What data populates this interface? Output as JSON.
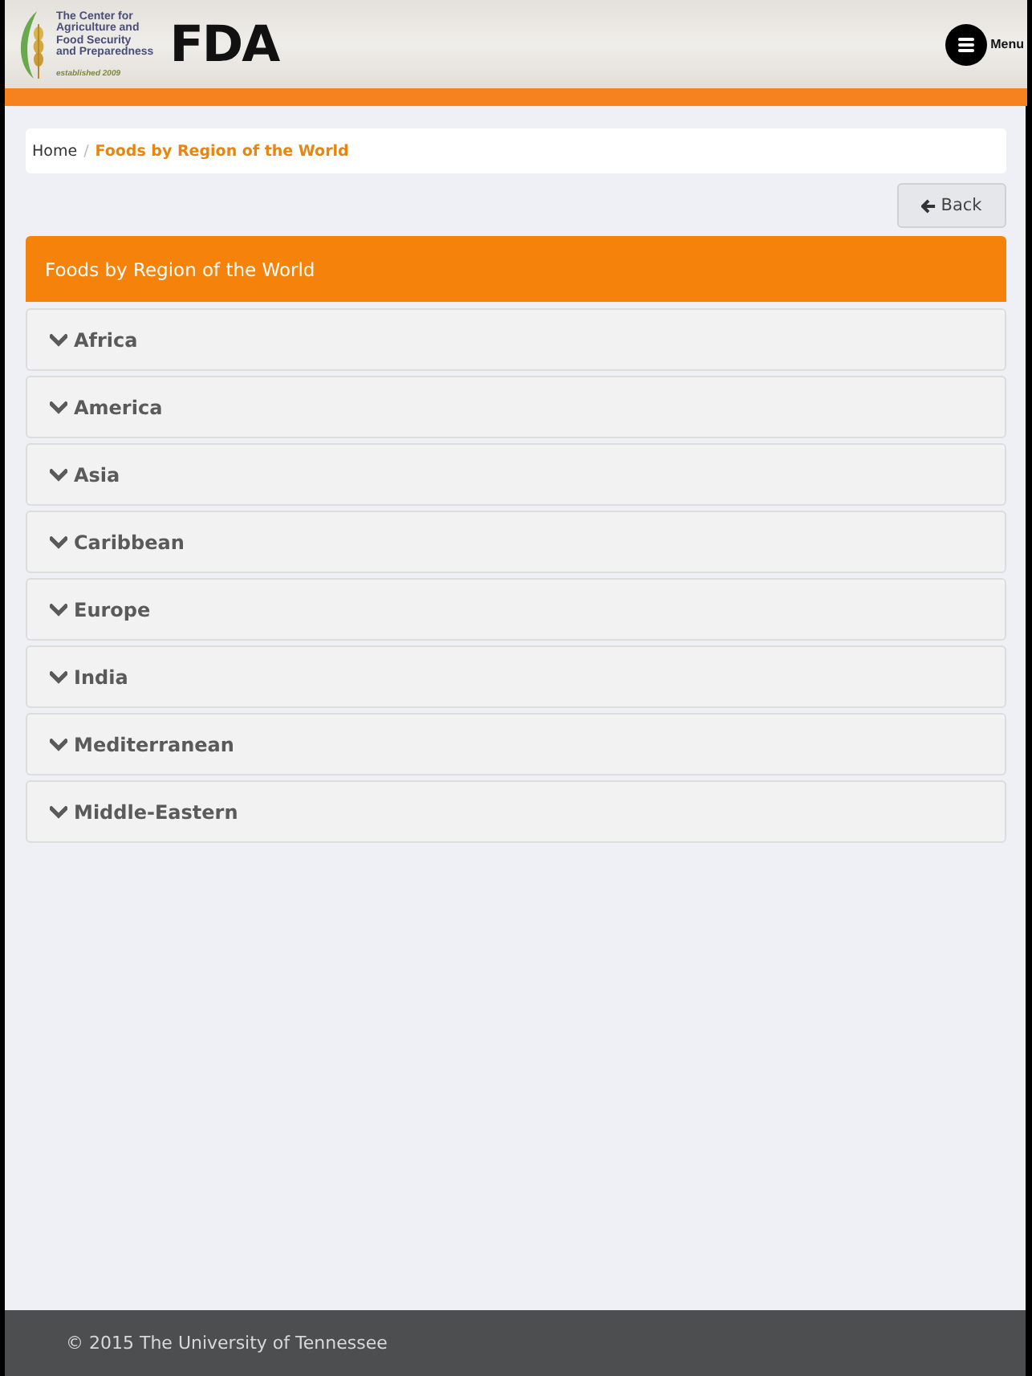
{
  "header": {
    "logo_lines": [
      "The Center for",
      "Agriculture and",
      "Food Security",
      "and Preparedness"
    ],
    "logo_year": "established 2009",
    "agency_logo": "FDA",
    "menu_button": {
      "label": "Menu"
    }
  },
  "breadcrumb": {
    "separator": "/",
    "items": [
      {
        "label": "Home",
        "selected": false
      },
      {
        "label": "Foods by Region of the World",
        "selected": true
      }
    ]
  },
  "back_button": {
    "label": "Back"
  },
  "panel": {
    "title": "Foods by Region of the World",
    "regions": [
      {
        "label": "Africa",
        "expanded": false
      },
      {
        "label": "America",
        "expanded": false
      },
      {
        "label": "Asia",
        "expanded": false
      },
      {
        "label": "Caribbean",
        "expanded": false
      },
      {
        "label": "Europe",
        "expanded": false
      },
      {
        "label": "India",
        "expanded": false
      },
      {
        "label": "Mediterranean",
        "expanded": false
      },
      {
        "label": "Middle-Eastern",
        "expanded": false
      }
    ]
  },
  "footer": {
    "text": "© 2015 The University of Tennessee"
  }
}
